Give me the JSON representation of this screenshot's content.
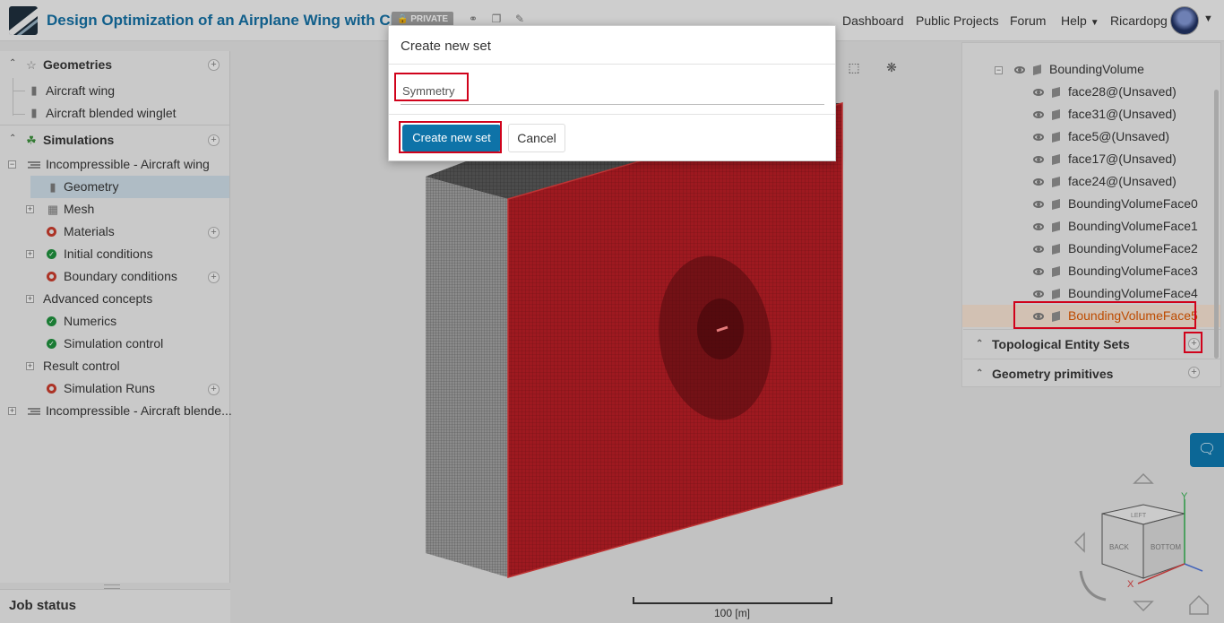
{
  "header": {
    "project_title": "Design Optimization of an Airplane Wing with CFD",
    "privacy_badge": "PRIVATE",
    "nav": [
      "Dashboard",
      "Public Projects",
      "Forum",
      "Help",
      "Ricardopg"
    ]
  },
  "left_tree": {
    "geometries_header": "Geometries",
    "geometries": [
      "Aircraft wing",
      "Aircraft blended winglet"
    ],
    "simulations_header": "Simulations",
    "simulation_1": "Incompressible - Aircraft wing",
    "sim1_children": {
      "geometry": "Geometry",
      "mesh": "Mesh",
      "materials": "Materials",
      "initial_conditions": "Initial conditions",
      "boundary_conditions": "Boundary conditions",
      "advanced_concepts": "Advanced concepts",
      "numerics": "Numerics",
      "simulation_control": "Simulation control",
      "result_control": "Result control",
      "simulation_runs": "Simulation Runs"
    },
    "simulation_2": "Incompressible - Aircraft blende..."
  },
  "job_status": "Job status",
  "right_tree": {
    "parent": "BoundingVolume",
    "faces": [
      "face28@(Unsaved)",
      "face31@(Unsaved)",
      "face5@(Unsaved)",
      "face17@(Unsaved)",
      "face24@(Unsaved)",
      "BoundingVolumeFace0",
      "BoundingVolumeFace1",
      "BoundingVolumeFace2",
      "BoundingVolumeFace3",
      "BoundingVolumeFace4",
      "BoundingVolumeFace5"
    ],
    "sections": [
      "Topological Entity Sets",
      "Geometry primitives"
    ]
  },
  "viewer": {
    "scale_label": "100 [m]",
    "cube_labels": [
      "BACK",
      "BOTTOM",
      "LEFT"
    ],
    "axis_labels": [
      "Y",
      "X"
    ]
  },
  "modal": {
    "title": "Create new set",
    "input_value": "Symmetry",
    "create_label": "Create new set",
    "cancel_label": "Cancel"
  },
  "colors": {
    "brand_blue": "#0e73a8",
    "title_blue": "#136a9b",
    "mesh_red": "#b01c24",
    "highlight_orange": "#d35400",
    "annotation_red": "#d0021b"
  }
}
